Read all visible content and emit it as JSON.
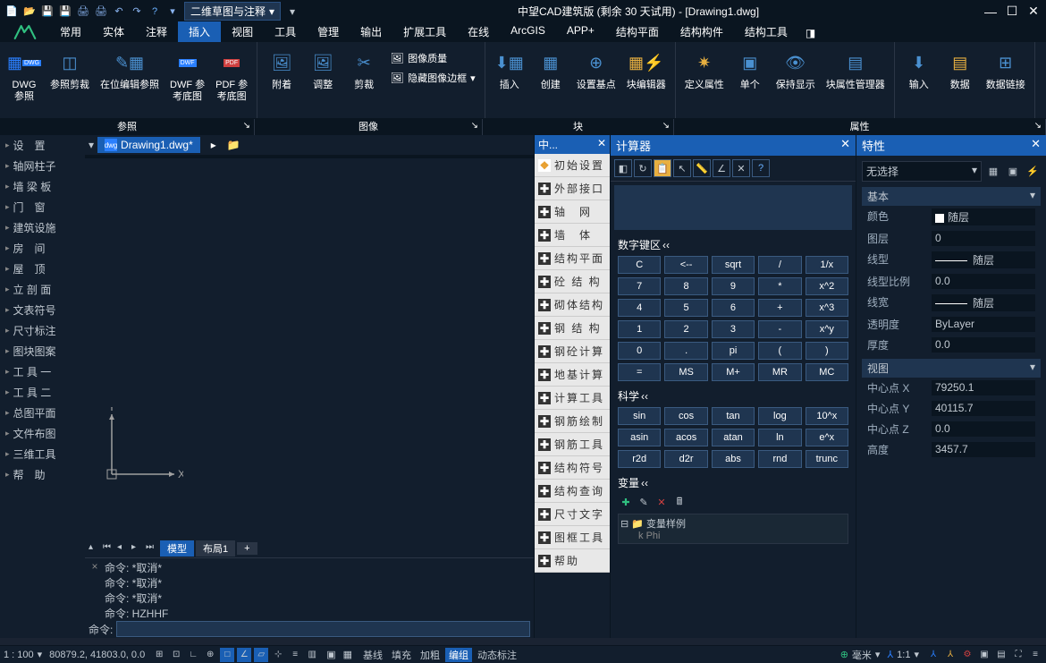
{
  "title": "中望CAD建筑版 (剩余 30 天试用) - [Drawing1.dwg]",
  "mode_select": "二维草图与注释",
  "menutabs": [
    "常用",
    "实体",
    "注释",
    "插入",
    "视图",
    "工具",
    "管理",
    "输出",
    "扩展工具",
    "在线",
    "ArcGIS",
    "APP+",
    "结构平面",
    "结构构件",
    "结构工具"
  ],
  "active_tab_index": 3,
  "ribbon": {
    "ref": {
      "dwg": "DWG\n参照",
      "clip": "参照剪裁",
      "edit": "在位编辑参照",
      "dwf": "DWF 参\n考底图",
      "pdf": "PDF 参\n考底图"
    },
    "img": {
      "attach": "附着",
      "adjust": "调整",
      "clip": "剪裁",
      "quality": "图像质量",
      "hide": "隐藏图像边框"
    },
    "block": {
      "insert": "插入",
      "create": "创建",
      "setbase": "设置基点",
      "blkedit": "块编辑器",
      "defattr": "定义属性",
      "single": "单个",
      "keepdisp": "保持显示",
      "attrmgr": "块属性管理器"
    },
    "misc": {
      "input": "输入",
      "data": "数据",
      "link": "数据链接"
    }
  },
  "panel_titles": [
    "参照",
    "图像",
    "块",
    "属性"
  ],
  "sidebar": [
    "设　置",
    "轴网柱子",
    "墙 梁 板",
    "门　窗",
    "建筑设施",
    "房　间",
    "屋　顶",
    "立 剖 面",
    "文表符号",
    "尺寸标注",
    "图块图案",
    "工 具 一",
    "工 具 二",
    "总图平面",
    "文件布图",
    "三维工具",
    "帮　助"
  ],
  "doc_tab": "Drawing1.dwg*",
  "axes": {
    "x": "X",
    "y": "Y"
  },
  "layout": {
    "model": "模型",
    "layout1": "布局1"
  },
  "cmd_history": [
    "命令: *取消*",
    "命令: *取消*",
    "命令: *取消*",
    "命令: HZHHF"
  ],
  "cmd_prompt": "命令:",
  "palette_title": "中...",
  "palette_items": [
    "初始设置",
    "外部接口",
    "轴　网",
    "墙　体",
    "结构平面",
    "砼 结 构",
    "砌体结构",
    "钢 结 构",
    "钢砼计算",
    "地基计算",
    "计算工具",
    "钢筋绘制",
    "钢筋工具",
    "结构符号",
    "结构查询",
    "尺寸文字",
    "图框工具",
    "帮助"
  ],
  "calc": {
    "title": "计算器",
    "section_num": "数字键区",
    "section_sci": "科学",
    "section_var": "变量",
    "num_btns": [
      "C",
      "<--",
      "sqrt",
      "/",
      "1/x",
      "7",
      "8",
      "9",
      "*",
      "x^2",
      "4",
      "5",
      "6",
      "+",
      "x^3",
      "1",
      "2",
      "3",
      "-",
      "x^y",
      "0",
      ".",
      "pi",
      "(",
      ")",
      "=",
      "MS",
      "M+",
      "MR",
      "MC"
    ],
    "sci_btns": [
      "sin",
      "cos",
      "tan",
      "log",
      "10^x",
      "asin",
      "acos",
      "atan",
      "ln",
      "e^x",
      "r2d",
      "d2r",
      "abs",
      "rnd",
      "trunc"
    ],
    "var_sample": "变量样例",
    "var_item": "Phi"
  },
  "props": {
    "title": "特性",
    "select": "无选择",
    "group_basic": "基本",
    "rows_basic": [
      {
        "k": "颜色",
        "v": "随层",
        "swatch": true
      },
      {
        "k": "图层",
        "v": "0"
      },
      {
        "k": "线型",
        "v": "随层",
        "line": true
      },
      {
        "k": "线型比例",
        "v": "0.0"
      },
      {
        "k": "线宽",
        "v": "随层",
        "line": true
      },
      {
        "k": "透明度",
        "v": "ByLayer"
      },
      {
        "k": "厚度",
        "v": "0.0"
      }
    ],
    "group_view": "视图",
    "rows_view": [
      {
        "k": "中心点 X",
        "v": "79250.1"
      },
      {
        "k": "中心点 Y",
        "v": "40115.7"
      },
      {
        "k": "中心点 Z",
        "v": "0.0"
      },
      {
        "k": "高度",
        "v": "3457.7"
      }
    ]
  },
  "status": {
    "scale": "1 : 100",
    "coords": "80879.2, 41803.0, 0.0",
    "text_toggles": [
      "基线",
      "填充",
      "加粗",
      "编组",
      "动态标注"
    ],
    "active_text": "编组",
    "unit": "毫米",
    "ratio": "1:1"
  }
}
